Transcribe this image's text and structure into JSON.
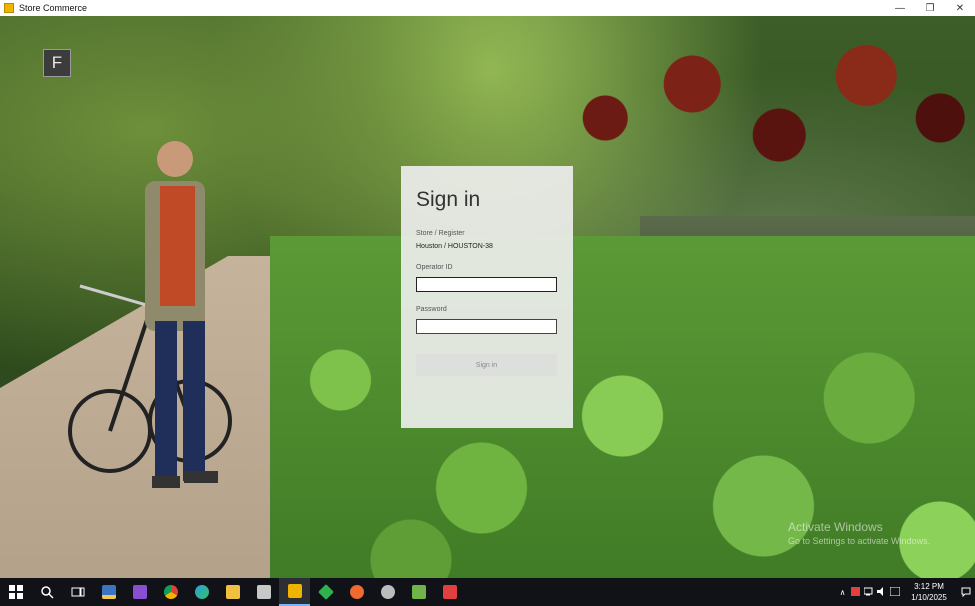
{
  "window": {
    "title": "Store Commerce",
    "minimize": "—",
    "restore": "❐",
    "close": "✕"
  },
  "user_avatar": {
    "initial": "F"
  },
  "signin": {
    "heading": "Sign in",
    "store_label": "Store / Register",
    "store_value": "Houston / HOUSTON-38",
    "operator_label": "Operator ID",
    "operator_value": "",
    "password_label": "Password",
    "password_value": "",
    "button_label": "Sign in"
  },
  "watermark": {
    "title": "Activate Windows",
    "subtitle": "Go to Settings to activate Windows."
  },
  "taskbar": {
    "apps": [
      {
        "name": "start-icon",
        "color": "#ffffff"
      },
      {
        "name": "search-icon",
        "color": "#ffffff"
      },
      {
        "name": "task-view-icon",
        "color": "#ffffff"
      },
      {
        "name": "python-icon",
        "color": "#3b74c2"
      },
      {
        "name": "visual-studio-icon",
        "color": "#8a4fd0"
      },
      {
        "name": "chrome-icon",
        "color": "#e0a020"
      },
      {
        "name": "edge-icon",
        "color": "#2a9fd8"
      },
      {
        "name": "file-explorer-icon",
        "color": "#f0c040"
      },
      {
        "name": "device-manager-icon",
        "color": "#c8c8c8"
      },
      {
        "name": "store-commerce-icon",
        "color": "#f0b400"
      },
      {
        "name": "green-diamond-icon",
        "color": "#2fb24d"
      },
      {
        "name": "postman-icon",
        "color": "#ef6a30"
      },
      {
        "name": "tool-icon",
        "color": "#bcbcbc"
      },
      {
        "name": "notepad-icon",
        "color": "#6fb34a"
      },
      {
        "name": "red-app-icon",
        "color": "#e04040"
      }
    ],
    "tray": {
      "chevron": "∧",
      "time": "3:12 PM",
      "date": "1/10/2025"
    }
  }
}
